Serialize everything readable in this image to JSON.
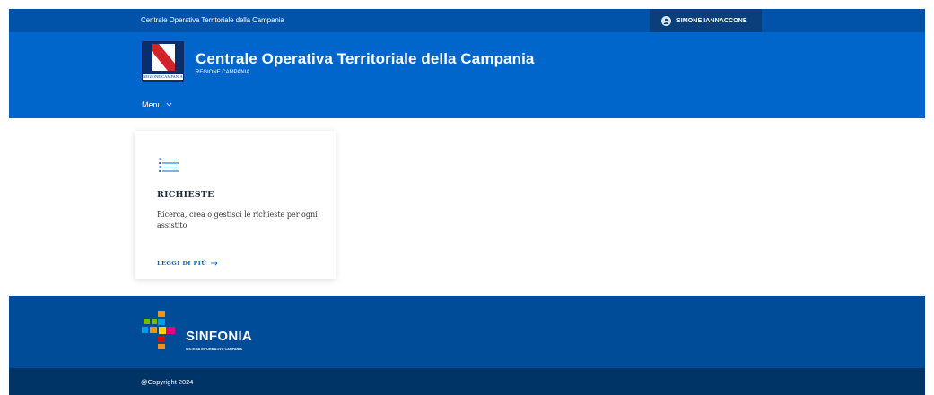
{
  "header": {
    "slim_title": "Centrale Operativa Territoriale della Campania",
    "user_name": "SIMONE IANNACCONE",
    "user_icon": "user-avatar-icon"
  },
  "brand": {
    "title": "Centrale Operativa Territoriale della Campania",
    "subtitle": "REGIONE CAMPANIA",
    "logo_caption": "REGIONE CAMPANIA"
  },
  "nav": {
    "menu_label": "Menu",
    "menu_icon": "chevron-down-icon"
  },
  "cards": [
    {
      "icon": "list-icon",
      "title": "RICHIESTE",
      "text": "Ricerca, crea o gestisci le richieste per ogni assistito",
      "link_label": "LEGGI DI PIÙ",
      "link_icon": "arrow-right-icon"
    }
  ],
  "footer": {
    "logo_name": "SINFONIA",
    "logo_sub": "SISTEMA INFORMATIVO CAMPANIA",
    "copyright": "@Copyright 2024"
  },
  "colors": {
    "slim_header": "#0053a8",
    "user_box": "#0a3f7c",
    "header": "#0066cc",
    "footer": "#004c99",
    "copyright_bar": "#003366",
    "link": "#0066cc"
  }
}
